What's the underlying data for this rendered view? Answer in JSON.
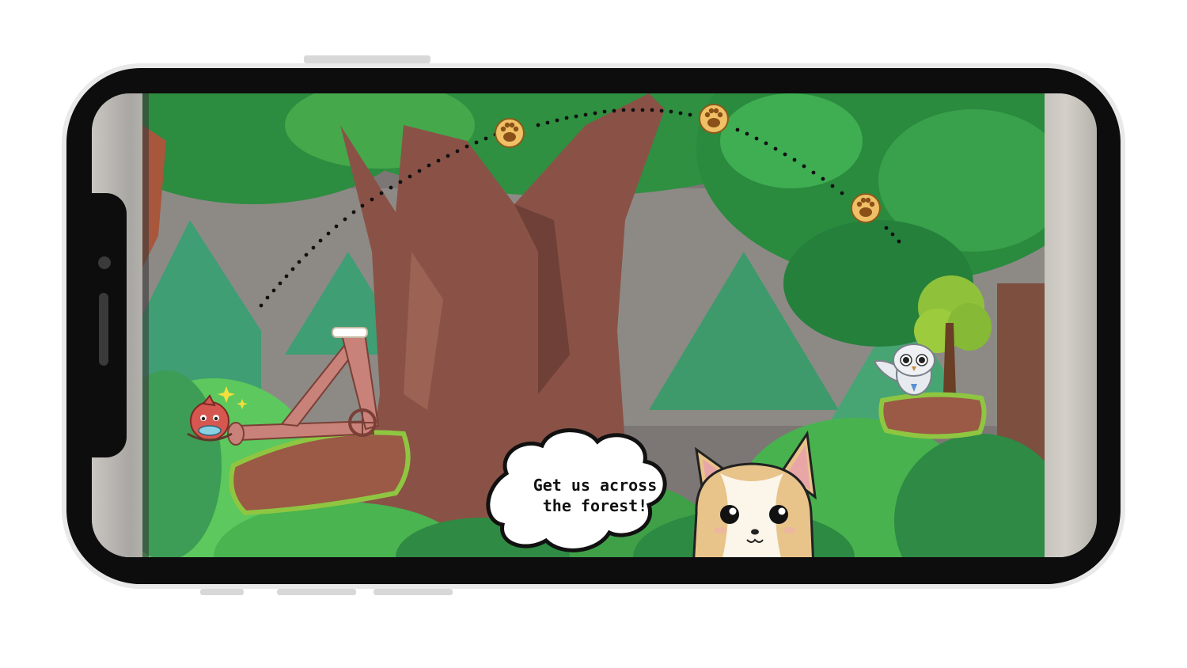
{
  "game": {
    "speech_bubble_text": "Get us across\nthe forest!",
    "collectible_icon": "paw-print-icon",
    "collectible_count_visible": 3,
    "characters": [
      "red-creature",
      "owl",
      "corgi"
    ]
  },
  "colors": {
    "frame": "#0d0d0d",
    "bezel": "#e9e9e9",
    "sky_gray": "#7c7774",
    "foliage_dark": "#2f8c45",
    "foliage_light": "#5bc25a",
    "trunk": "#8a5246",
    "ground": "#9a5a45",
    "grass_rim": "#8fc641",
    "coin": "#d99a3a"
  }
}
